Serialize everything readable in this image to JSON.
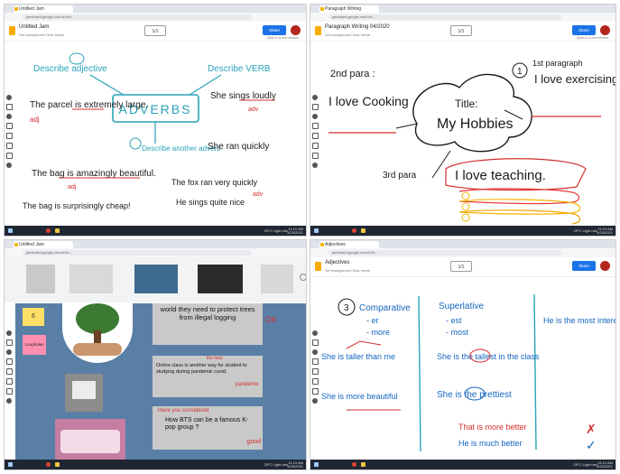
{
  "panels": {
    "adverbs": {
      "tab": "Untitled Jam",
      "url": "jamboard.google.com/d/1sH...",
      "title": "Untitled Jam",
      "menu": "Set background  Clear frame",
      "pager": "1/1",
      "share": "Share",
      "hint": "Open in a new window",
      "center": "ADVERBS",
      "describe_adjective": "Describe adjective",
      "describe_verb": "Describe VERB",
      "describe_adverb": "Describe another adverb",
      "s1": "The parcel is extremely large.",
      "s2": "She sings loudly",
      "s3": "She ran quickly",
      "s4": "The fox ran very quickly",
      "s5": "The bag is amazingly beautiful.",
      "s6": "The bag is surprisingly cheap!",
      "s7": "He sings quite nice",
      "adj": "adj",
      "adv": "adv"
    },
    "paragraph": {
      "tab": "Paragraph Writing",
      "url": "jamboard.google.com/d/1...",
      "title": "Paragraph Writing 04/2020",
      "menu": "Set background  Clear frame",
      "pager": "1/1",
      "share": "Share",
      "hint": "Open in a new window",
      "para1_num": "1",
      "para1_label": "1st paragraph",
      "para1_text": "I love exercising",
      "para2_label": "2nd para :",
      "para2_text": "I love Cooking",
      "title_label": "Title:",
      "title_text": "My Hobbies",
      "para3_label": "3rd para",
      "para3_text": "I love teaching."
    },
    "trees": {
      "tab": "Untitled Jam",
      "url": "jamboard.google.com/d/1e...",
      "sticky1": "6",
      "sticky2": "Loopholes",
      "box1": "world they need to protect trees from illegal logging",
      "box1_mark": "OK",
      "box2_mark": "the best",
      "box2": "Online class is another way for student to studying during pandemic covid.",
      "box2_edit": "pandemic",
      "box3_mark": "Have you considered",
      "box3": "How BTS can be a famous K-pop group ?",
      "box3_note": "good"
    },
    "comparative": {
      "tab": "Adjectives",
      "url": "jamboard.google.com/d/1h...",
      "title": "Adjectives",
      "menu": "Set background  Clear frame",
      "pager": "1/1",
      "share": "Share",
      "num": "3",
      "comparative": "Comparative",
      "comp_er": "- er",
      "comp_more": "- more",
      "superlative": "Superlative",
      "sup_est": "- est",
      "sup_most": "- most",
      "c1": "She is taller than me",
      "c2": "She is more beautiful",
      "s1": "She is the tallest in the class",
      "s2": "She is the prettiest",
      "r1": "He is the most interesting man",
      "w1": "That is more better",
      "w2": "He is much better"
    }
  },
  "taskbar": {
    "weather": "29°C Light rain",
    "time": "11:10 AM",
    "date": "4/20/2021"
  },
  "colors": {
    "blue": "#1565c0",
    "red": "#d32f2f",
    "black": "#1a1a1a",
    "teal": "#29a3b8",
    "slate": "#5a7fa6",
    "jam_yellow": "#f9ab00"
  }
}
